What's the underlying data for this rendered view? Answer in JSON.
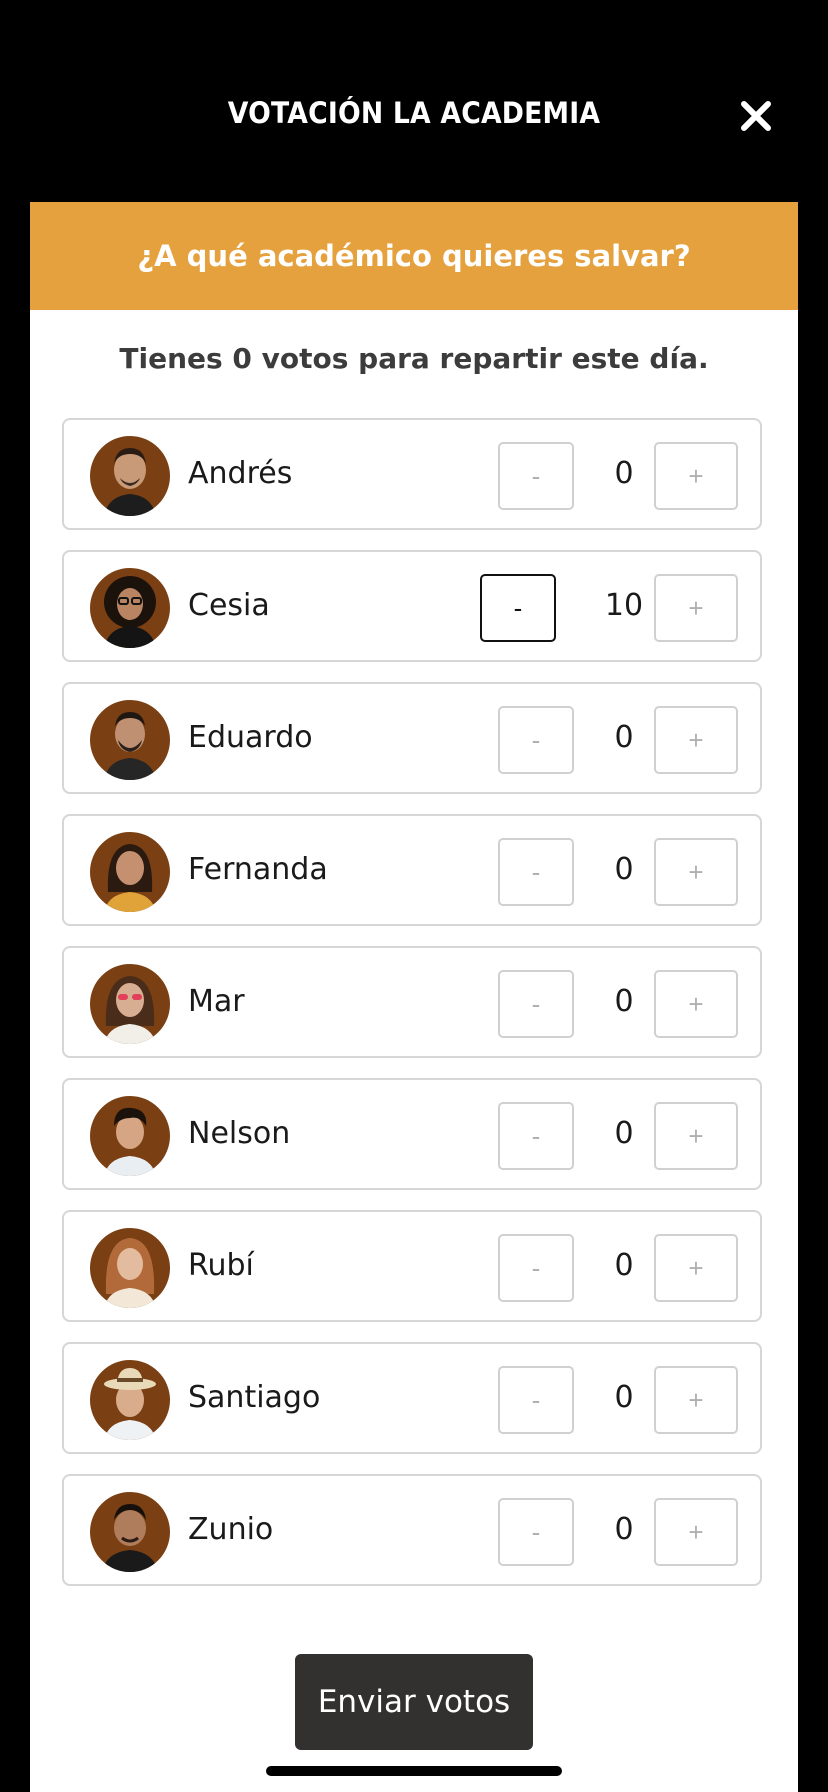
{
  "header": {
    "title": "VOTACIÓN LA ACADEMIA",
    "close_icon": "close-icon"
  },
  "panel": {
    "question": "¿A qué académico quieres salvar?",
    "subtitle": "Tienes 0 votos para repartir este día.",
    "accent_color": "#e6a13f"
  },
  "candidates": [
    {
      "name": "Andrés",
      "votes": "0",
      "minus": "-",
      "plus": "+"
    },
    {
      "name": "Cesia",
      "votes": "10",
      "minus": "-",
      "plus": "+"
    },
    {
      "name": "Eduardo",
      "votes": "0",
      "minus": "-",
      "plus": "+"
    },
    {
      "name": "Fernanda",
      "votes": "0",
      "minus": "-",
      "plus": "+"
    },
    {
      "name": "Mar",
      "votes": "0",
      "minus": "-",
      "plus": "+"
    },
    {
      "name": "Nelson",
      "votes": "0",
      "minus": "-",
      "plus": "+"
    },
    {
      "name": "Rubí",
      "votes": "0",
      "minus": "-",
      "plus": "+"
    },
    {
      "name": "Santiago",
      "votes": "0",
      "minus": "-",
      "plus": "+"
    },
    {
      "name": "Zunio",
      "votes": "0",
      "minus": "-",
      "plus": "+"
    }
  ],
  "actions": {
    "submit_label": "Enviar votos"
  }
}
